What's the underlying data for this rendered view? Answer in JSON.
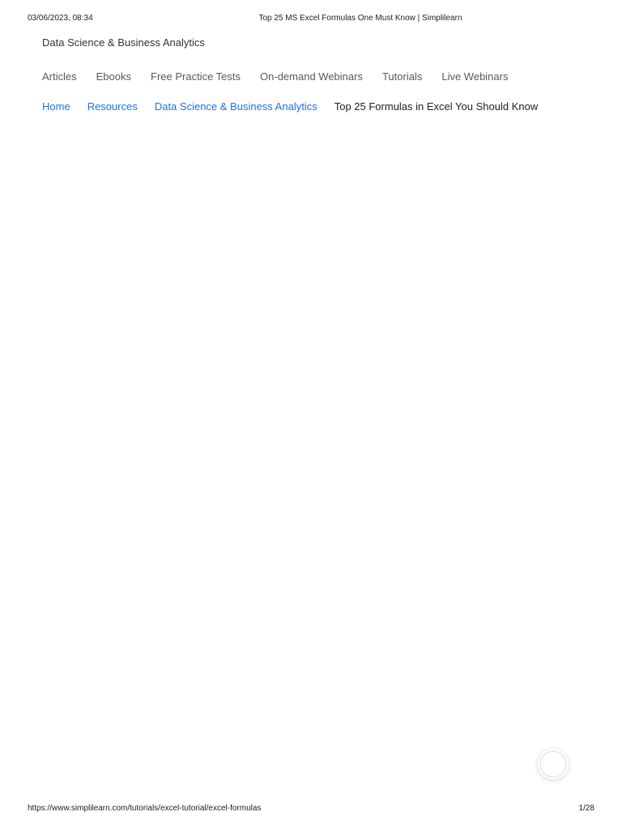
{
  "print_header": {
    "date": "03/06/2023, 08:34",
    "title": "Top 25 MS Excel Formulas One Must Know | Simplilearn"
  },
  "section": {
    "title": "Data Science & Business Analytics"
  },
  "nav": {
    "items": [
      {
        "label": "Articles"
      },
      {
        "label": "Ebooks"
      },
      {
        "label": "Free Practice Tests"
      },
      {
        "label": "On-demand Webinars"
      },
      {
        "label": "Tutorials"
      },
      {
        "label": "Live Webinars"
      }
    ]
  },
  "breadcrumb": {
    "items": [
      {
        "label": "Home"
      },
      {
        "label": "Resources"
      },
      {
        "label": "Data Science & Business Analytics"
      }
    ],
    "current": "Top 25 Formulas in Excel You Should Know"
  },
  "chat_widget": {
    "icon": "chat-bubble-icon"
  },
  "print_footer": {
    "url": "https://www.simplilearn.com/tutorials/excel-tutorial/excel-formulas",
    "page": "1/28"
  },
  "colors": {
    "link": "#1a73e8",
    "nav_text": "#595959",
    "text": "#222222"
  }
}
